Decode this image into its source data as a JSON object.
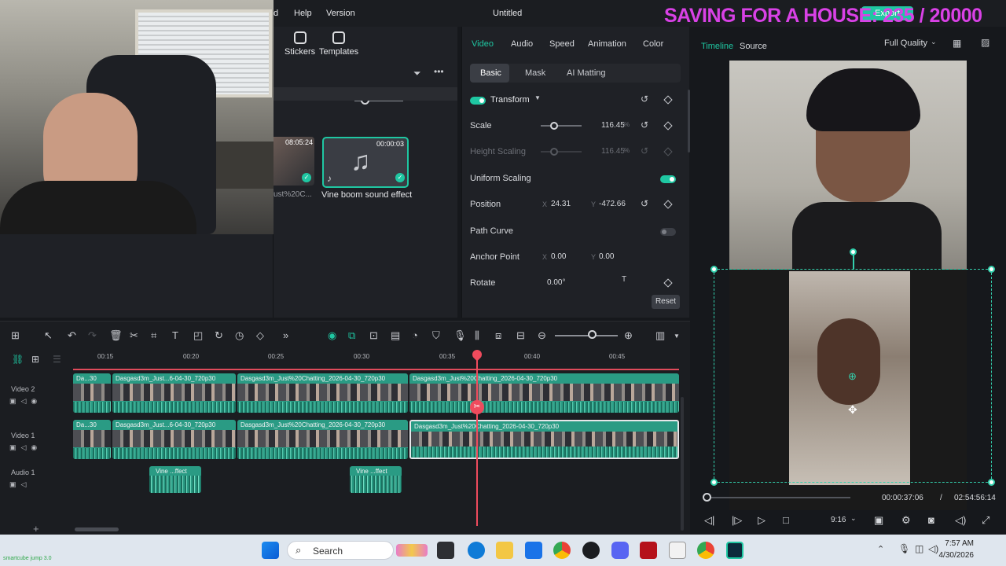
{
  "menubar": {
    "items": [
      "d",
      "Help",
      "Version"
    ],
    "title": "Untitled",
    "overlay_text": "SAVING FOR A HOUSE: 235 / 20000",
    "export_label": "Export"
  },
  "media_panel": {
    "tools": [
      {
        "label": "Stickers",
        "icon": "sticker-icon"
      },
      {
        "label": "Templates",
        "icon": "template-icon"
      }
    ],
    "items": [
      {
        "duration": "08:05:24",
        "label": "ust%20C..."
      },
      {
        "duration": "00:00:03",
        "label": "Vine boom sound effect"
      }
    ]
  },
  "properties": {
    "tabs": [
      "Video",
      "Audio",
      "Speed",
      "Animation",
      "Color"
    ],
    "active_tab": "Video",
    "subtabs": [
      "Basic",
      "Mask",
      "AI Matting"
    ],
    "section": "Transform",
    "scale": {
      "label": "Scale",
      "value": "116.45",
      "unit": "%"
    },
    "height_scaling": {
      "label": "Height Scaling",
      "value": "116.45",
      "unit": "%"
    },
    "uniform_scaling": {
      "label": "Uniform Scaling"
    },
    "position": {
      "label": "Position",
      "x_label": "X",
      "x": "24.31",
      "y_label": "Y",
      "y": "-472.66"
    },
    "path_curve": {
      "label": "Path Curve"
    },
    "anchor_point": {
      "label": "Anchor Point",
      "x_label": "X",
      "x": "0.00",
      "y_label": "Y",
      "y": "0.00"
    },
    "rotate": {
      "label": "Rotate",
      "value": "0.00°"
    },
    "reset_label": "Reset"
  },
  "preview": {
    "tabs": [
      "Timeline",
      "Source"
    ],
    "quality": "Full Quality",
    "current_time": "00:00:37:06",
    "separator": "/",
    "total_time": "02:54:56:14",
    "ratio": "9:16"
  },
  "timeline": {
    "ruler": [
      "00:15",
      "00:20",
      "00:25",
      "00:30",
      "00:35",
      "00:40",
      "00:45"
    ],
    "tracks": [
      {
        "name": "Video 2",
        "clips": [
          "Da...30",
          "Dasgasd3m_Just...6-04-30_720p30",
          "Dasgasd3m_Just%20Chatting_2026-04-30_720p30",
          "Dasgasd3m_Just%20Chatting_2026-04-30_720p30"
        ]
      },
      {
        "name": "Video 1",
        "clips": [
          "Da...30",
          "Dasgasd3m_Just...6-04-30_720p30",
          "Dasgasd3m_Just%20Chatting_2026-04-30_720p30",
          "Dasgasd3m_Just%20Chatting_2026-04-30_720p30"
        ]
      },
      {
        "name": "Audio 1",
        "clips": [
          "Vine ...ffect",
          "Vine ...ffect"
        ]
      }
    ]
  },
  "taskbar": {
    "search_placeholder": "Search",
    "time": "7:57 AM",
    "date": "4/30/2026",
    "watermark": "smartcube jump 3.0"
  },
  "colors": {
    "accent": "#1fc7a2",
    "playhead": "#ef4b5d",
    "overlay": "#d941e6"
  }
}
